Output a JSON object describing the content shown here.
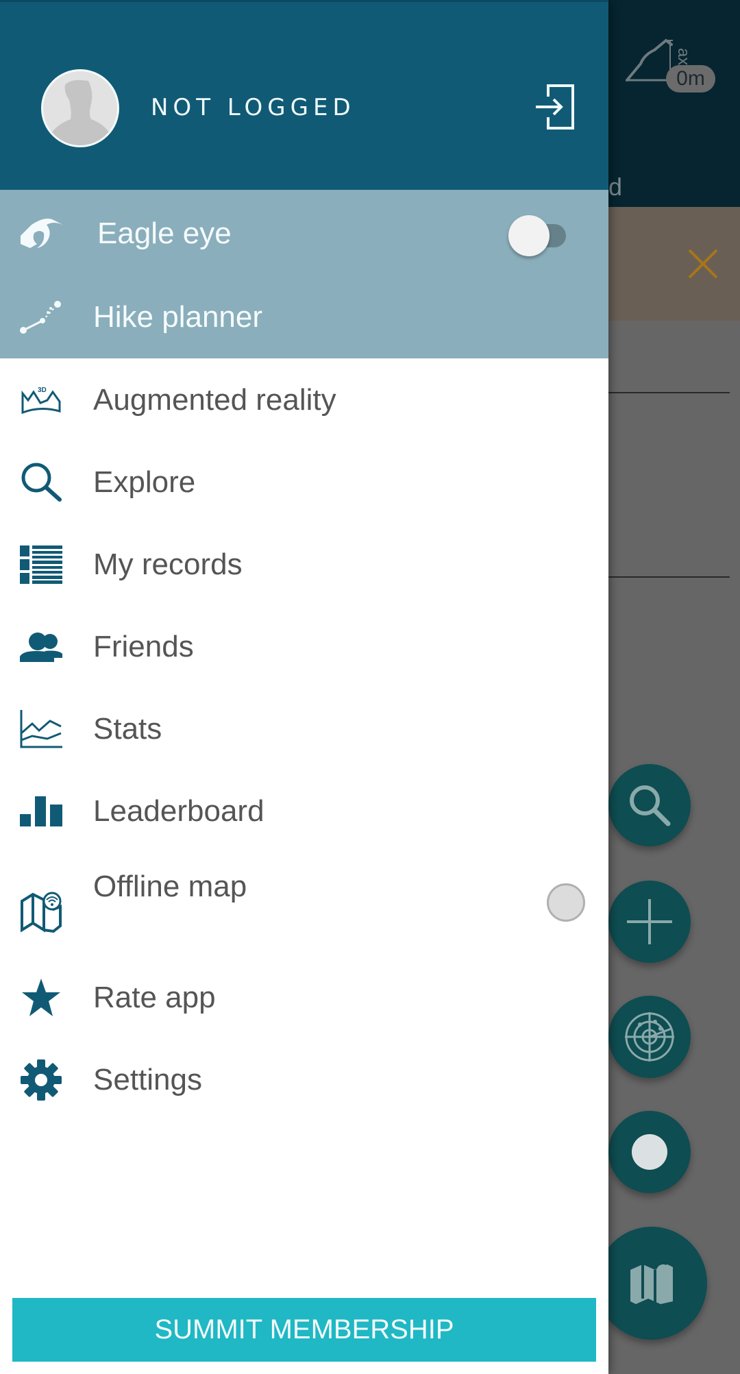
{
  "header": {
    "user_name": "NOT LOGGED",
    "avatar_icon": "user-silhouette-icon",
    "login_icon": "login-icon"
  },
  "menu": {
    "highlighted": [
      {
        "label": "Eagle eye",
        "icon": "eagle-eye-icon",
        "toggle": false
      },
      {
        "label": "Hike planner",
        "icon": "route-planner-icon"
      }
    ],
    "items": [
      {
        "label": "Augmented reality",
        "icon": "3d-mountains-icon"
      },
      {
        "label": "Explore",
        "icon": "search-icon"
      },
      {
        "label": "My records",
        "icon": "list-icon"
      },
      {
        "label": "Friends",
        "icon": "friends-icon"
      },
      {
        "label": "Stats",
        "icon": "line-chart-icon"
      },
      {
        "label": "Leaderboard",
        "icon": "bar-chart-icon"
      },
      {
        "label": "Offline map",
        "icon": "offline-map-icon",
        "radio": false
      },
      {
        "label": "Rate app",
        "icon": "star-icon"
      },
      {
        "label": "Settings",
        "icon": "gear-icon"
      }
    ]
  },
  "cta": {
    "label": "SUMMIT MEMBERSHIP"
  },
  "background": {
    "elevation_badge": "0m",
    "elevation_label": "ax",
    "partial_text": "d",
    "fabs": [
      "search-icon",
      "plus-icon",
      "radar-icon",
      "record-icon",
      "map-icon"
    ]
  },
  "colors": {
    "header": "#115a75",
    "highlight": "#8aaebb",
    "icon": "#115a75",
    "cta": "#1fb8c4",
    "fab": "#0e4d52"
  }
}
